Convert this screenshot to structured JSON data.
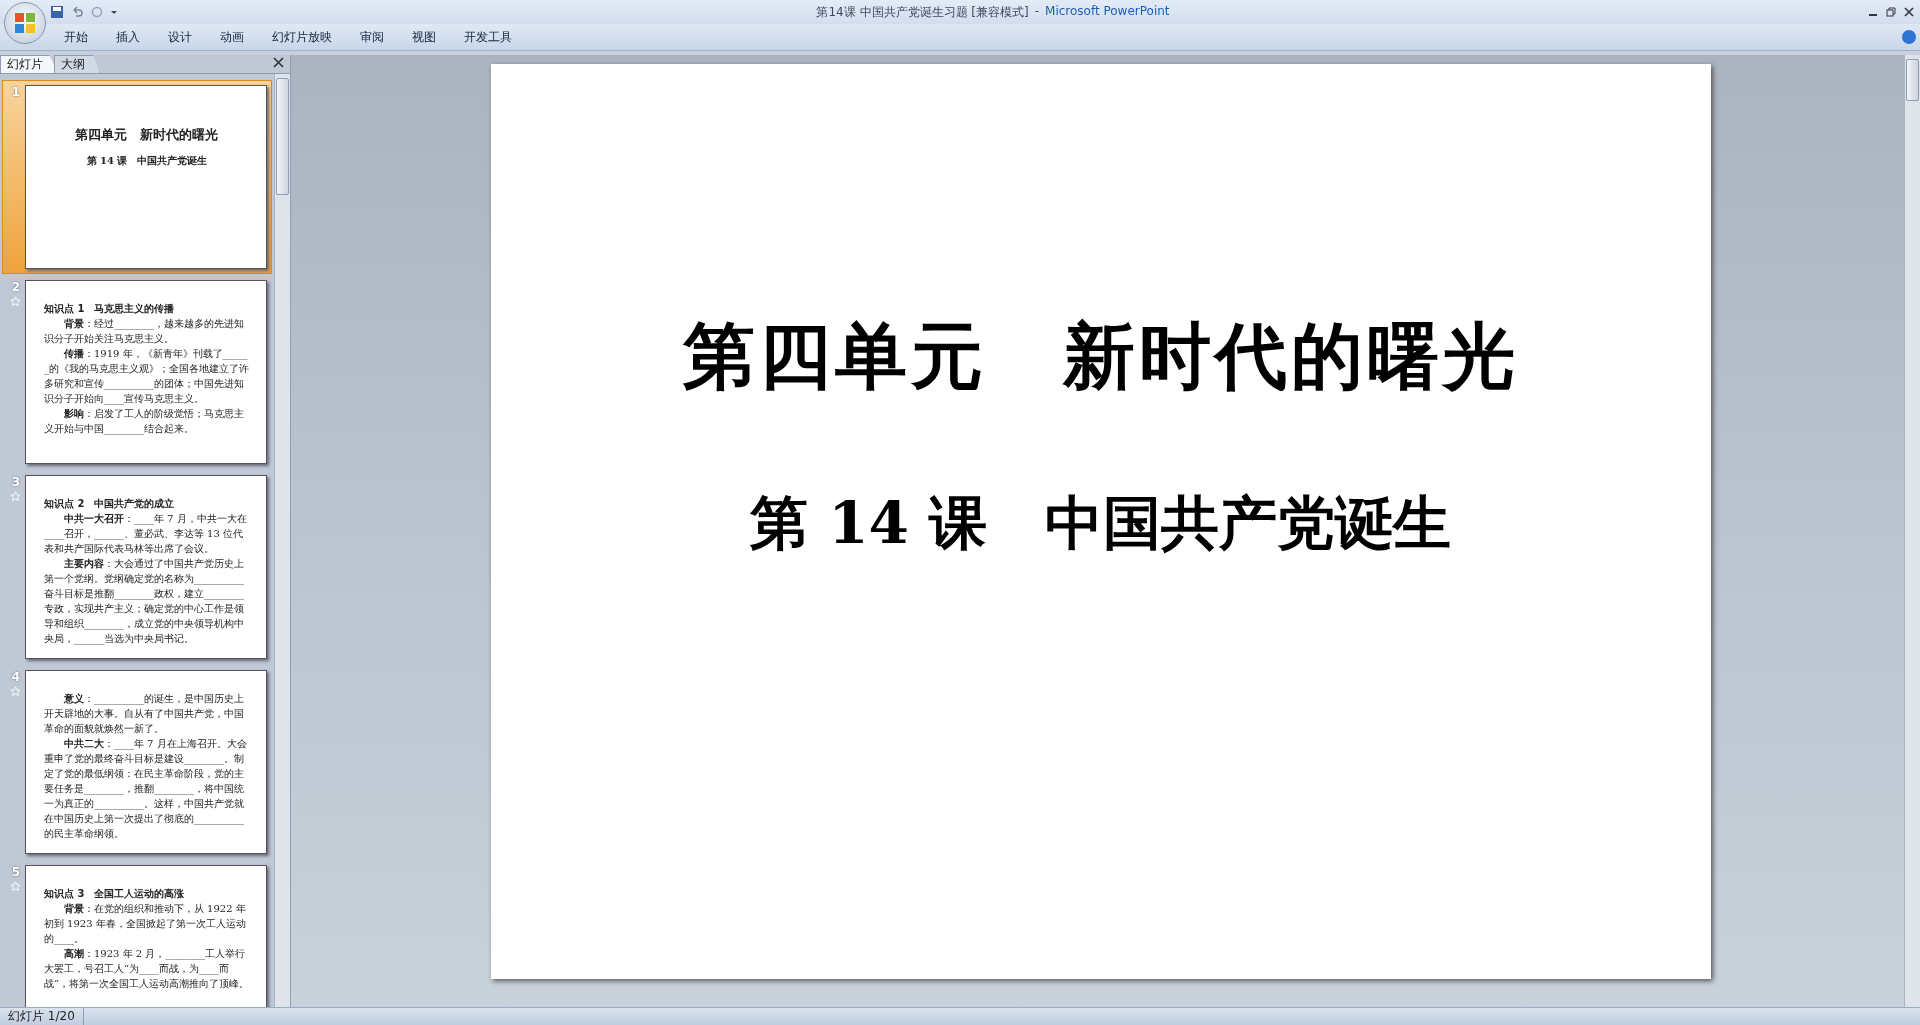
{
  "window": {
    "title": "第14课  中国共产党诞生习题 [兼容模式]",
    "separator": "-",
    "app_name": "Microsoft PowerPoint"
  },
  "ribbon_tabs": [
    "开始",
    "插入",
    "设计",
    "动画",
    "幻灯片放映",
    "审阅",
    "视图",
    "开发工具"
  ],
  "panel_tabs": [
    {
      "label": "幻灯片",
      "selected": true
    },
    {
      "label": "大纲",
      "selected": false
    }
  ],
  "thumbnails": [
    {
      "number": "1",
      "selected": true,
      "animated": false,
      "kind": "title",
      "title": "第四单元　新时代的曙光",
      "subtitle": "第 14 课　中国共产党诞生"
    },
    {
      "number": "2",
      "selected": false,
      "animated": true,
      "kind": "text",
      "heading": "知识点 1　马克思主义的传播",
      "paragraphs": [
        "**背景**：经过________，越来越多的先进知识分子开始关注马克思主义。",
        "**传播**：1919 年，《新青年》刊载了______的《我的马克思主义观》；全国各地建立了许多研究和宣传__________的团体；中国先进知识分子开始向____宣传马克思主义。",
        "**影响**：启发了工人的阶级觉悟；马克思主义开始与中国________结合起来。"
      ]
    },
    {
      "number": "3",
      "selected": false,
      "animated": true,
      "kind": "text",
      "heading": "知识点 2　中国共产党的成立",
      "paragraphs": [
        "**中共一大召开**：____年 7 月，中共一大在____召开，______、董必武、李达等 13 位代表和共产国际代表马林等出席了会议。",
        "**主要内容**：大会通过了中国共产党历史上第一个党纲。党纲确定党的名称为__________奋斗目标是推翻________政权，建立________专政，实现共产主义；确定党的中心工作是领导和组织________，成立党的中央领导机构中央局，______当选为中央局书记。"
      ]
    },
    {
      "number": "4",
      "selected": false,
      "animated": true,
      "kind": "text",
      "paragraphs": [
        "**意义**：__________的诞生，是中国历史上开天辟地的大事。自从有了中国共产党，中国革命的面貌就焕然一新了。",
        "**中共二大**：____年 7 月在上海召开。大会重申了党的最终奋斗目标是建设________。制定了党的最低纲领：在民主革命阶段，党的主要任务是________，推翻________，将中国统一为真正的__________。这样，中国共产党就在中国历史上第一次提出了彻底的__________的民主革命纲领。"
      ]
    },
    {
      "number": "5",
      "selected": false,
      "animated": true,
      "kind": "text",
      "heading": "知识点 3　全国工人运动的高涨",
      "paragraphs": [
        "**背景**：在党的组织和推动下，从 1922 年初到 1923 年春，全国掀起了第一次工人运动的____。",
        "**高潮**：1923 年 2 月，________工人举行大罢工，号召工人“为____而战，为____而战”，将第一次全国工人运动高潮推向了顶峰。"
      ]
    }
  ],
  "slide": {
    "title": "第四单元　新时代的曙光",
    "subtitle": "第 14 课　中国共产党诞生"
  },
  "status_bar": {
    "slide_count": "幻灯片 1/20"
  }
}
